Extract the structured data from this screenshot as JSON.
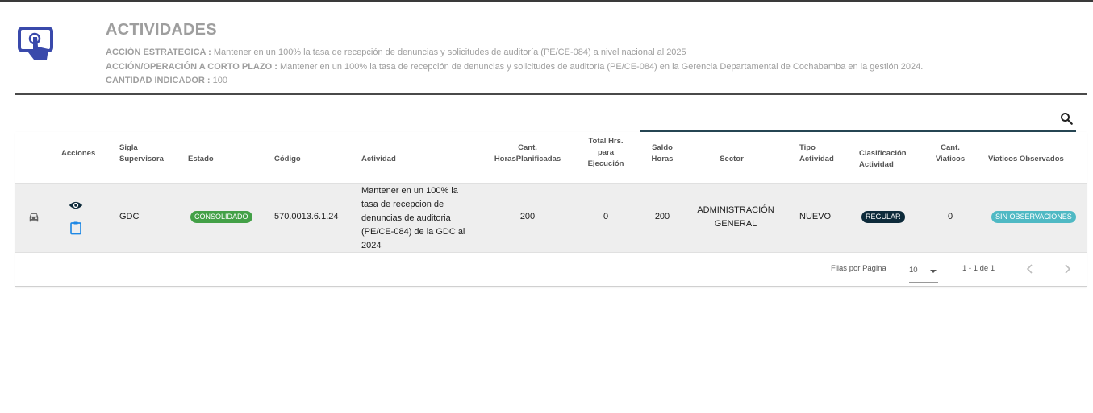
{
  "header": {
    "title": "ACTIVIDADES",
    "accion_estrategica_label": "ACCIÓN ESTRATEGICA :",
    "accion_estrategica_value": "Mantener en un 100% la tasa de recepción de denuncias y solicitudes de auditoría (PE/CE-084) a nivel nacional al 2025",
    "accion_corto_label": "ACCIÓN/OPERACIÓN A CORTO PLAZO :",
    "accion_corto_value": "Mantener en un 100% la tasa de recepción de denuncias y solicitudes de auditoría (PE/CE-084) en la Gerencia Departamental de Cochabamba en la gestión 2024.",
    "cantidad_label": "CANTIDAD INDICADOR :",
    "cantidad_value": "100",
    "logo_icon": "touch-screen-icon"
  },
  "search": {
    "value": "",
    "icon": "search-icon"
  },
  "table": {
    "headers": {
      "acciones": "Acciones",
      "sigla_1": "Sigla",
      "sigla_2": "Supervisora",
      "estado": "Estado",
      "codigo": "Código",
      "actividad": "Actividad",
      "horas_1": "Cant.",
      "horas_2": "HorasPlanificadas",
      "total_1": "Total Hrs.",
      "total_2": "para",
      "total_3": "Ejecución",
      "saldo_1": "Saldo",
      "saldo_2": "Horas",
      "sector": "Sector",
      "tipo_1": "Tipo",
      "tipo_2": "Actividad",
      "clasif_1": "Clasificación",
      "clasif_2": "Actividad",
      "viaticos_1": "Cant.",
      "viaticos_2": "Viaticos",
      "observados": "Viaticos Observados"
    },
    "rows": [
      {
        "row_icon": "car-icon",
        "view_icon": "eye-icon",
        "clipboard_icon": "clipboard-icon",
        "sigla": "GDC",
        "estado": "CONSOLIDADO",
        "estado_color": "#43a047",
        "codigo": "570.0013.6.1.24",
        "actividad": [
          "Mantener en un 100% la",
          "tasa de recepcion de",
          "denuncias de auditoria",
          "(PE/CE-084) de la GDC al",
          "2024"
        ],
        "horas_planificadas": "200",
        "total_hrs": "0",
        "saldo_horas": "200",
        "sector": [
          "ADMINISTRACIÓN",
          "GENERAL"
        ],
        "tipo": "NUEVO",
        "clasificacion": "REGULAR",
        "clasificacion_color": "#0d2a3a",
        "cant_viaticos": "0",
        "observados": "SIN OBSERVACIONES",
        "observados_color": "#4fb9c4"
      }
    ]
  },
  "footer": {
    "rows_per_page_label": "Filas por Página",
    "rows_per_page_value": "10",
    "range": "1 - 1 de 1",
    "prev_icon": "chevron-left-icon",
    "next_icon": "chevron-right-icon"
  },
  "colors": {
    "accent": "#3949ab",
    "divider": "#4a4a4a",
    "search_line": "#264653"
  }
}
